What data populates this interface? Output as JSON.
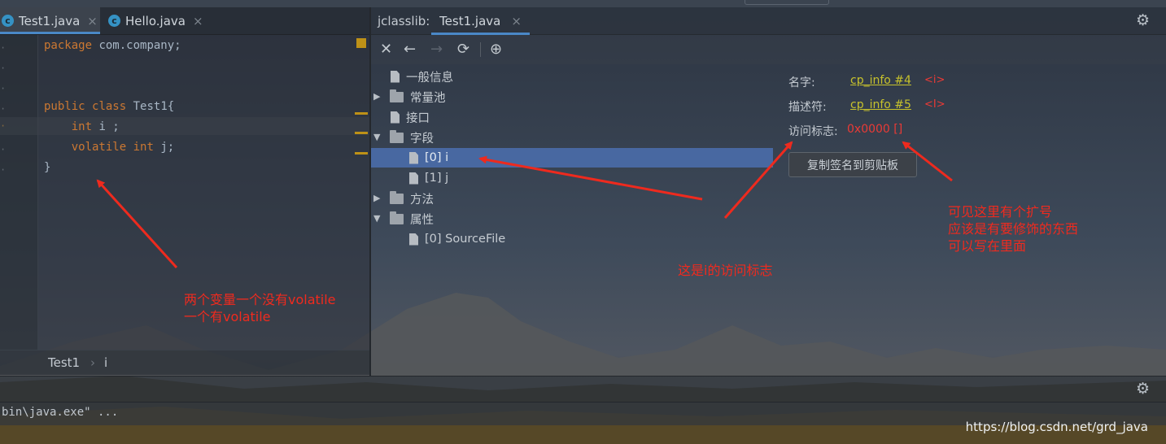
{
  "editor": {
    "tabs": [
      {
        "icon": "c",
        "label": "Test1.java",
        "close": "×"
      },
      {
        "icon": "c",
        "label": "Hello.java",
        "close": "×"
      }
    ],
    "code": {
      "l1": {
        "kw": "package",
        "rest": " com.company;"
      },
      "l3": {
        "kw1": "public",
        "kw2": "class",
        "rest": " Test1{"
      },
      "l4": {
        "kw": "int",
        "rest": " i ;"
      },
      "l5": {
        "kw1": "volatile",
        "kw2": "int",
        "rest": " j;"
      },
      "l6": "}"
    },
    "breadcrumb": [
      "Test1",
      "›",
      "i"
    ]
  },
  "jclasslib": {
    "title": "jclasslib:",
    "tab": {
      "label": "Test1.java",
      "close": "×"
    },
    "toolbar": {
      "close": "✕",
      "back": "←",
      "forward": "→",
      "refresh": "⟳",
      "browser": "⊕"
    },
    "tree": [
      "一般信息",
      "常量池",
      "接口",
      "字段",
      "[0] i",
      "[1] j",
      "方法",
      "属性",
      "[0] SourceFile"
    ],
    "props": {
      "name_label": "名字:",
      "name_link": "cp_info #4",
      "name_value": "<i>",
      "desc_label": "描述符:",
      "desc_link": "cp_info #5",
      "desc_value": "<I>",
      "access_label": "访问标志:",
      "access_value": "0x0000 []",
      "copy_button": "复制签名到剪贴板"
    }
  },
  "annotations": {
    "left": "两个变量一个没有volatile\n一个有volatile",
    "middle": "这是i的访问标志",
    "right": "可见这里有个扩号\n应该是有要修饰的东西\n可以写在里面"
  },
  "console": {
    "text": "bin\\java.exe\" ..."
  },
  "watermark": "https://blog.csdn.net/grd_java",
  "icons": [
    "gear-icon",
    "java-class-icon",
    "file-icon",
    "folder-icon"
  ]
}
